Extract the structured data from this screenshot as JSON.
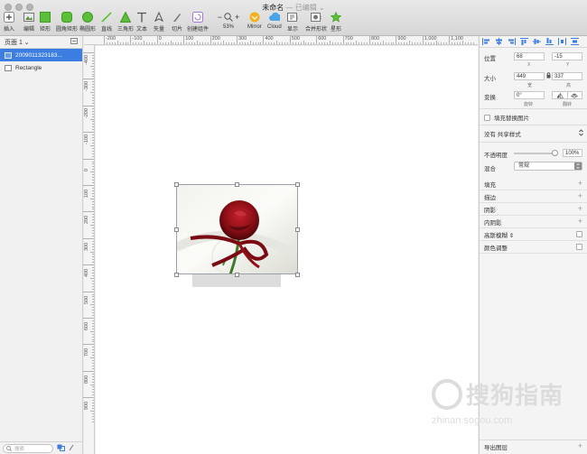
{
  "window": {
    "title": "未命名",
    "status": "— 已编辑 ⌄"
  },
  "toolbar": {
    "items": [
      {
        "label": "插入",
        "icon": "plus-icon"
      },
      {
        "label": "编辑",
        "icon": "edit-icon"
      },
      {
        "label": "矩形",
        "icon": "rectangle-icon"
      },
      {
        "label": "圆角矩形",
        "icon": "rounded-rectangle-icon"
      },
      {
        "label": "椭圆形",
        "icon": "oval-icon"
      },
      {
        "label": "直线",
        "icon": "line-icon"
      },
      {
        "label": "三角形",
        "icon": "triangle-icon"
      },
      {
        "label": "文本",
        "icon": "text-icon"
      },
      {
        "label": "矢量",
        "icon": "vector-pen-icon"
      },
      {
        "label": "切片",
        "icon": "slice-icon"
      },
      {
        "label": "创建组件",
        "icon": "create-symbol-icon"
      },
      {
        "label": "53%",
        "icon": "zoom-icon"
      },
      {
        "label": "Mirror",
        "icon": "mirror-icon"
      },
      {
        "label": "Cloud",
        "icon": "cloud-icon"
      },
      {
        "label": "显示",
        "icon": "view-icon"
      },
      {
        "label": "合并形状",
        "icon": "combine-shapes-icon"
      },
      {
        "label": "星形",
        "icon": "star-icon"
      }
    ],
    "zoom_minus": "−",
    "zoom_plus": "+"
  },
  "sidebar": {
    "page_label": "页面 1 ⌄",
    "layers": [
      {
        "name": "2009011323183...",
        "selected": true
      },
      {
        "name": "Rectangle",
        "selected": false
      }
    ],
    "search_placeholder": "搜索"
  },
  "rulers": {
    "h": [
      "-200",
      "-100",
      "0",
      "100",
      "200",
      "300",
      "400",
      "500",
      "600",
      "700",
      "800",
      "900",
      "1,000",
      "1,100"
    ],
    "v": [
      "-400",
      "-300",
      "-200",
      "-100",
      "0",
      "100",
      "200",
      "300",
      "400",
      "500",
      "600",
      "700",
      "800",
      "900"
    ]
  },
  "inspector": {
    "position_label": "位置",
    "x_value": "68",
    "y_value": "-15",
    "x_sub": "X",
    "y_sub": "Y",
    "size_label": "大小",
    "width_value": "449",
    "height_value": "337",
    "width_sub": "宽",
    "height_sub": "高",
    "transform_label": "变换",
    "rotate_value": "0°",
    "rotate_sub": "旋转",
    "flip_sub": "翻转",
    "fill_replace_label": "填充替换图片",
    "shared_style": "没有 共享样式",
    "opacity_label": "不透明度",
    "opacity_value": "100%",
    "opacity": 1.0,
    "blend_label": "混合",
    "blend_value": "常规",
    "sections": [
      {
        "label": "填充",
        "control": "plus"
      },
      {
        "label": "描边",
        "control": "plus"
      },
      {
        "label": "阴影",
        "control": "plus"
      },
      {
        "label": "内阴影",
        "control": "plus"
      },
      {
        "label": "高斯模糊 ⇕",
        "control": "check"
      },
      {
        "label": "颜色调整",
        "control": "check"
      }
    ],
    "export_label": "导出图层"
  },
  "watermark": {
    "text": "搜狗指南",
    "url": "zhinan.sogou.com"
  },
  "colors": {
    "selection": "#3b7de0",
    "toolbar_green": "#5bbf3a",
    "rose": "#8e0f17"
  }
}
